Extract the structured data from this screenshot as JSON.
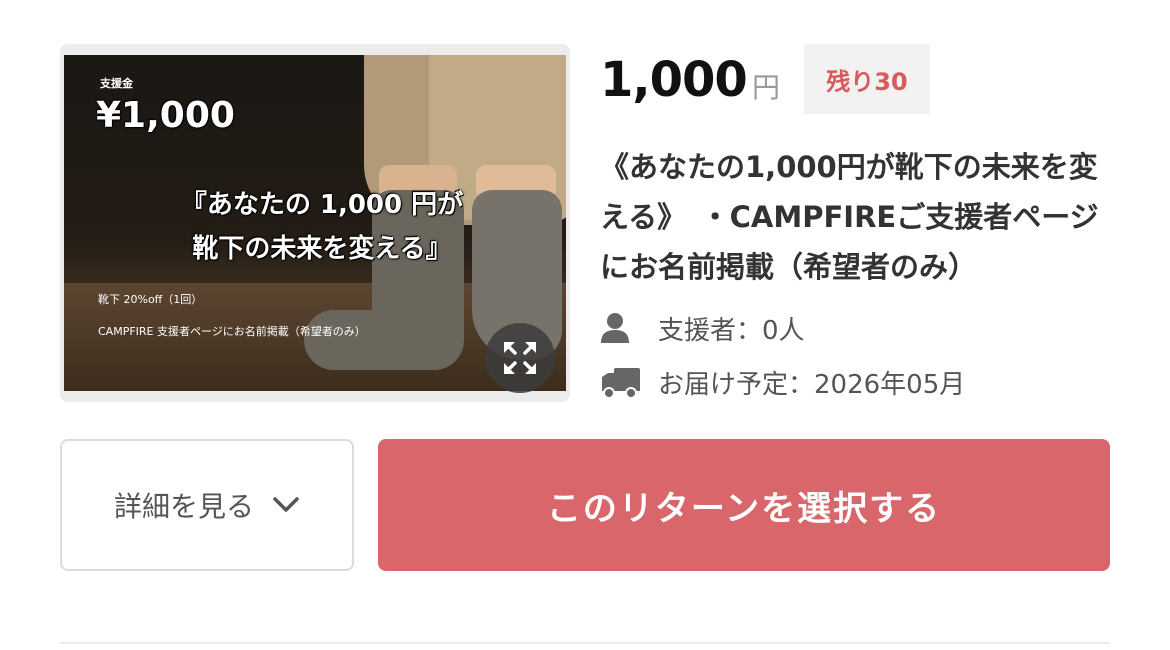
{
  "thumbnail": {
    "small_label": "支援金",
    "price_text": "¥1,000",
    "headline_line1": "『あなたの 1,000 円が",
    "headline_line2": "靴下の未来を変える』",
    "line1": "靴下 20%off（1回）",
    "line2": "CAMPFIRE 支援者ページにお名前掲載（希望者のみ）",
    "expand_icon": "expand-icon"
  },
  "reward": {
    "price": "1,000",
    "currency": "円",
    "remaining": "残り30",
    "title": "《あなたの1,000円が靴下の未来を変える》　・CAMPFIREご支援者ページにお名前掲載（希望者のみ）",
    "supporters": "支援者：0人",
    "delivery": "お届け予定：2026年05月"
  },
  "icons": {
    "supporters": "person-icon",
    "delivery": "truck-icon",
    "details": "chevron-down-icon"
  },
  "buttons": {
    "details": "詳細を見る",
    "select": "このリターンを選択する"
  },
  "colors": {
    "accent": "#d9666a",
    "remaining_text": "#d85a5a"
  }
}
